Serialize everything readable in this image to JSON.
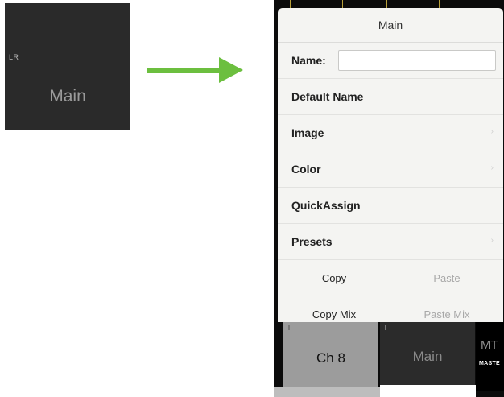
{
  "tile": {
    "badge": "LR",
    "name": "Main"
  },
  "popover": {
    "title": "Main",
    "name_label": "Name:",
    "name_value": "",
    "items": [
      {
        "label": "Default Name",
        "chevron": ""
      },
      {
        "label": "Image",
        "chevron": "›"
      },
      {
        "label": "Color",
        "chevron": "›"
      },
      {
        "label": "QuickAssign",
        "chevron": ""
      },
      {
        "label": "Presets",
        "chevron": "›"
      }
    ],
    "copy": "Copy",
    "paste": "Paste",
    "copy_mix": "Copy Mix",
    "paste_mix": "Paste Mix"
  },
  "channels": {
    "ch8": "Ch 8",
    "main": "Main",
    "mt": "MT",
    "master": "MASTE"
  },
  "colors": {
    "arrow": "#6cbf3f",
    "popover_bg": "#f4f4f2",
    "tile_bg": "#2a2a2a"
  }
}
